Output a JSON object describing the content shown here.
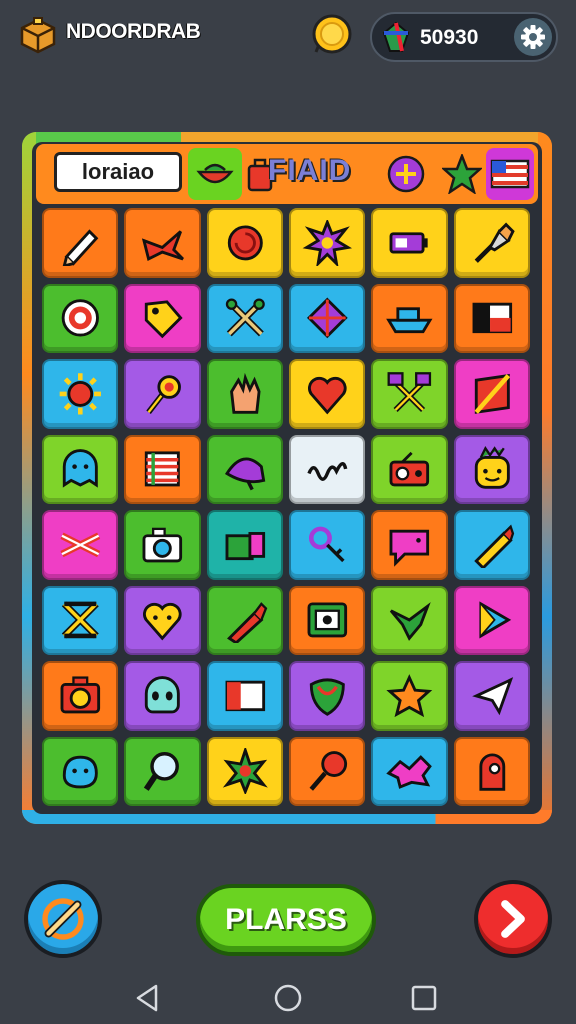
{
  "header": {
    "game_title": "NDOORDRAB",
    "currency_value": "50930"
  },
  "board": {
    "label_chip": "loraiao",
    "flaid_text": "FIAID"
  },
  "play_button": "PLARSS",
  "icons": {
    "logo": "treasure-chest-icon",
    "coin": "gold-coin-icon",
    "gem": "gem-icon",
    "settings": "gear-icon",
    "left_button": "candy-stick-icon",
    "right_button": "chevron-right-icon",
    "nav": [
      "back-icon",
      "home-icon",
      "recents-icon"
    ]
  },
  "colors": {
    "background": "#3a3f47",
    "board_orange": "#ff8a1e",
    "play_green": "#6ad321",
    "next_red": "#ee2d2d",
    "left_blue": "#2aa8e8"
  },
  "header_items": [
    {
      "name": "tomato-icon",
      "bg": "#6ad321"
    },
    {
      "name": "bag-icon",
      "bg": "none"
    },
    {
      "name": "plus-badge-icon",
      "bg": "none"
    },
    {
      "name": "star-badge-icon",
      "bg": "none"
    },
    {
      "name": "flag-icon",
      "bg": "#cf38d8"
    }
  ],
  "tiles": [
    {
      "name": "pencil-tile",
      "color": "#ff7a1a",
      "glyph": "pencil",
      "row": 0,
      "col": 0
    },
    {
      "name": "ribbon-tile",
      "color": "#ff7a1a",
      "glyph": "ribbon",
      "row": 0,
      "col": 1
    },
    {
      "name": "rose-tile",
      "color": "#ffd21a",
      "glyph": "rose",
      "row": 0,
      "col": 2
    },
    {
      "name": "sun-badge-tile",
      "color": "#ffd21a",
      "glyph": "sunbadge",
      "row": 0,
      "col": 3
    },
    {
      "name": "battery-tile",
      "color": "#ffd21a",
      "glyph": "battery",
      "row": 0,
      "col": 4
    },
    {
      "name": "brush-tile",
      "color": "#ffd21a",
      "glyph": "brush",
      "row": 0,
      "col": 5
    },
    {
      "name": "target-tile",
      "color": "#4cbe2e",
      "glyph": "target",
      "row": 1,
      "col": 0
    },
    {
      "name": "tag-tile",
      "color": "#ef3ec5",
      "glyph": "tag",
      "row": 1,
      "col": 1
    },
    {
      "name": "crossed-tools-tile",
      "color": "#2fb6ea",
      "glyph": "cross",
      "row": 1,
      "col": 2
    },
    {
      "name": "kite-tile",
      "color": "#2fb6ea",
      "glyph": "kite",
      "row": 1,
      "col": 3
    },
    {
      "name": "boat-tile",
      "color": "#ff7a1a",
      "glyph": "boat",
      "row": 1,
      "col": 4
    },
    {
      "name": "flag-tile",
      "color": "#ff7a1a",
      "glyph": "flag",
      "row": 1,
      "col": 5
    },
    {
      "name": "sun-tile",
      "color": "#2fb6ea",
      "glyph": "sun",
      "row": 2,
      "col": 0
    },
    {
      "name": "torch-tile",
      "color": "#a45ae6",
      "glyph": "torch",
      "row": 2,
      "col": 1
    },
    {
      "name": "hand-tile",
      "color": "#4cbe2e",
      "glyph": "hand",
      "row": 2,
      "col": 2
    },
    {
      "name": "heart-tile",
      "color": "#ffd21a",
      "glyph": "heart",
      "row": 2,
      "col": 3
    },
    {
      "name": "hammers-tile",
      "color": "#7fd42a",
      "glyph": "hammers",
      "row": 2,
      "col": 4
    },
    {
      "name": "banner-tile",
      "color": "#ef3ec5",
      "glyph": "banner",
      "row": 2,
      "col": 5
    },
    {
      "name": "ghost-tile",
      "color": "#7fd42a",
      "glyph": "ghost",
      "row": 3,
      "col": 0
    },
    {
      "name": "poster-tile",
      "color": "#ff7a1a",
      "glyph": "poster",
      "row": 3,
      "col": 1
    },
    {
      "name": "fish-tile",
      "color": "#4cbe2e",
      "glyph": "fish",
      "row": 3,
      "col": 2
    },
    {
      "name": "scribble-tile",
      "color": "#e8f1f6",
      "glyph": "scribble",
      "row": 3,
      "col": 3
    },
    {
      "name": "radio-tile",
      "color": "#7fd42a",
      "glyph": "radio",
      "row": 3,
      "col": 4
    },
    {
      "name": "face-tile",
      "color": "#a45ae6",
      "glyph": "face",
      "row": 3,
      "col": 5
    },
    {
      "name": "knot-tile",
      "color": "#ef3ec5",
      "glyph": "knot",
      "row": 4,
      "col": 0
    },
    {
      "name": "camera-tile",
      "color": "#4cbe2e",
      "glyph": "camera",
      "row": 4,
      "col": 1
    },
    {
      "name": "gift-tile",
      "color": "#1fb3a8",
      "glyph": "gift",
      "row": 4,
      "col": 2
    },
    {
      "name": "key-tile",
      "color": "#2fb6ea",
      "glyph": "key",
      "row": 4,
      "col": 3
    },
    {
      "name": "speech-tile",
      "color": "#ff7a1a",
      "glyph": "speech",
      "row": 4,
      "col": 4
    },
    {
      "name": "crayon-tile",
      "color": "#2fb6ea",
      "glyph": "crayon",
      "row": 4,
      "col": 5
    },
    {
      "name": "sandglass-tile",
      "color": "#2fb6ea",
      "glyph": "sandglass",
      "row": 5,
      "col": 0
    },
    {
      "name": "smiley-tile",
      "color": "#a45ae6",
      "glyph": "smiley",
      "row": 5,
      "col": 1
    },
    {
      "name": "marker-tile",
      "color": "#4cbe2e",
      "glyph": "marker",
      "row": 5,
      "col": 2
    },
    {
      "name": "photo-tile",
      "color": "#ff7a1a",
      "glyph": "photo",
      "row": 5,
      "col": 3
    },
    {
      "name": "dragon-tile",
      "color": "#7fd42a",
      "glyph": "dragon",
      "row": 5,
      "col": 4
    },
    {
      "name": "play-tile",
      "color": "#ef3ec5",
      "glyph": "play",
      "row": 5,
      "col": 5
    },
    {
      "name": "camera2-tile",
      "color": "#ff7a1a",
      "glyph": "camera2",
      "row": 6,
      "col": 0
    },
    {
      "name": "alien-tile",
      "color": "#a45ae6",
      "glyph": "alien",
      "row": 6,
      "col": 1
    },
    {
      "name": "card-tile",
      "color": "#2fb6ea",
      "glyph": "card",
      "row": 6,
      "col": 2
    },
    {
      "name": "leaf-tile",
      "color": "#a45ae6",
      "glyph": "leaf",
      "row": 6,
      "col": 3
    },
    {
      "name": "star-tile",
      "color": "#7fd42a",
      "glyph": "star",
      "row": 6,
      "col": 4
    },
    {
      "name": "plane-tile",
      "color": "#a45ae6",
      "glyph": "plane",
      "row": 6,
      "col": 5
    },
    {
      "name": "blob-tile",
      "color": "#4cbe2e",
      "glyph": "blob",
      "row": 7,
      "col": 0
    },
    {
      "name": "magnifier-tile",
      "color": "#4cbe2e",
      "glyph": "magnifier",
      "row": 7,
      "col": 1
    },
    {
      "name": "burst-tile",
      "color": "#ffd21a",
      "glyph": "burst",
      "row": 7,
      "col": 2
    },
    {
      "name": "lollipop-tile",
      "color": "#ff7a1a",
      "glyph": "lollipop",
      "row": 7,
      "col": 3
    },
    {
      "name": "splash-tile",
      "color": "#2fb6ea",
      "glyph": "splash",
      "row": 7,
      "col": 4
    },
    {
      "name": "glove-tile",
      "color": "#ff7a1a",
      "glyph": "glove",
      "row": 7,
      "col": 5
    }
  ]
}
